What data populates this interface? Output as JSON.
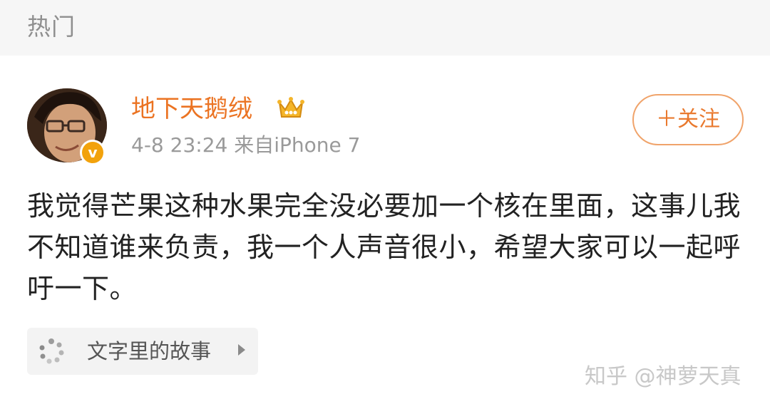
{
  "section": {
    "title": "热门"
  },
  "post": {
    "author": {
      "name": "地下天鹅绒",
      "avatar_icon": "avatar-photo",
      "verified_badge_icon": "verified-v-icon",
      "verified_badge_text": "v",
      "crown_icon": "crown-icon"
    },
    "meta": "4-8 23:24  来自iPhone 7",
    "follow_label": "＋关注",
    "body": "我觉得芒果这种水果完全没必要加一个核在里面，这事儿我不知道谁来负责，我一个人声音很小，希望大家可以一起呼吁一下。",
    "topic": {
      "icon": "topic-dots-icon",
      "label": "文字里的故事",
      "arrow_icon": "chevron-right-icon"
    }
  },
  "watermark": "知乎 @神萝天真",
  "colors": {
    "name_orange": "#eb7322",
    "follow_orange": "#e9792e",
    "meta_gray": "#9a9a9a",
    "badge_gold": "#f2a20c"
  }
}
